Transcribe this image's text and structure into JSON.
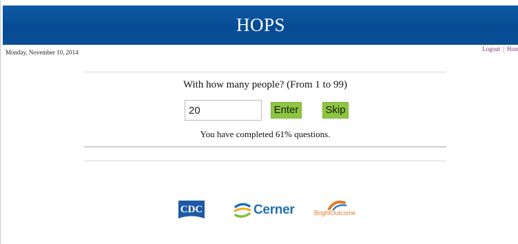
{
  "header": {
    "title": "HOPS"
  },
  "date_text": "Monday, November 10, 2014",
  "nav": {
    "logout_label": "Logout",
    "separator": "|",
    "home_label": "Home"
  },
  "question": {
    "prompt": "With how many people? (From 1 to 99)",
    "input_value": "20",
    "enter_label": "Enter",
    "skip_label": "Skip",
    "progress_text": "You have completed 61% questions."
  },
  "logos": {
    "cdc_text": "CDC",
    "cerner_text": "Cerner",
    "bright_text": "BrightOutcome"
  },
  "colors": {
    "header_bg": "#0a4f98",
    "button_green": "#8dc63f",
    "link_purple": "#8b2a7f"
  }
}
